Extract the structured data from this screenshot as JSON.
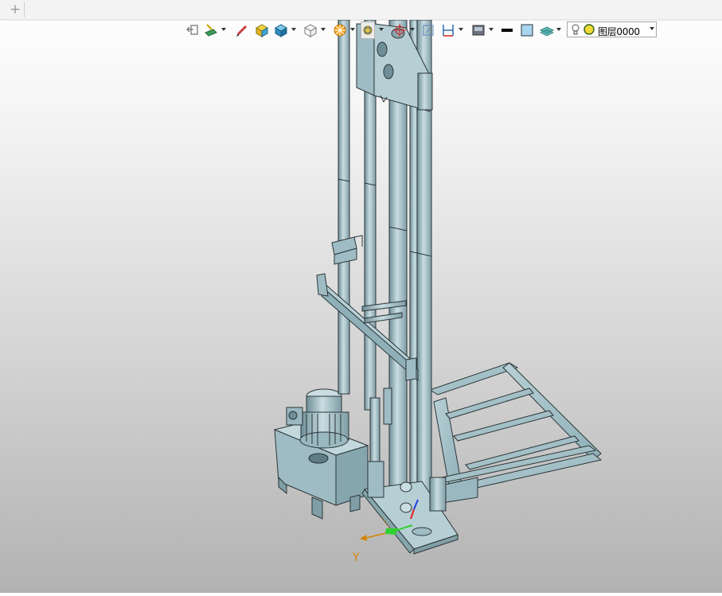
{
  "tabbar": {
    "add_tab_label": "+"
  },
  "toolbar": {
    "icons": [
      "exit-sketch-icon",
      "sketch-plane-icon",
      "pencil-icon",
      "shaded-box-icon",
      "solid-box-icon",
      "wireframe-cube-icon",
      "render-style-icon",
      "view-icon",
      "snap-target-icon",
      "zoom-fit-icon",
      "dimension-icon",
      "display-mode-icon",
      "line-color-icon",
      "face-color-icon",
      "layers-icon"
    ],
    "layer_combo": {
      "value": "图层0000",
      "icons": [
        "bulb-icon",
        "yellow-dot-icon"
      ]
    }
  },
  "viewport": {
    "triad_y_label": "Y"
  },
  "colors": {
    "model_fill": "#a7c4cc",
    "model_stroke": "#2b3538",
    "axis_x": "#e02020",
    "axis_y": "#30d030",
    "axis_z": "#2040e0",
    "axis_label": "#d48300"
  }
}
